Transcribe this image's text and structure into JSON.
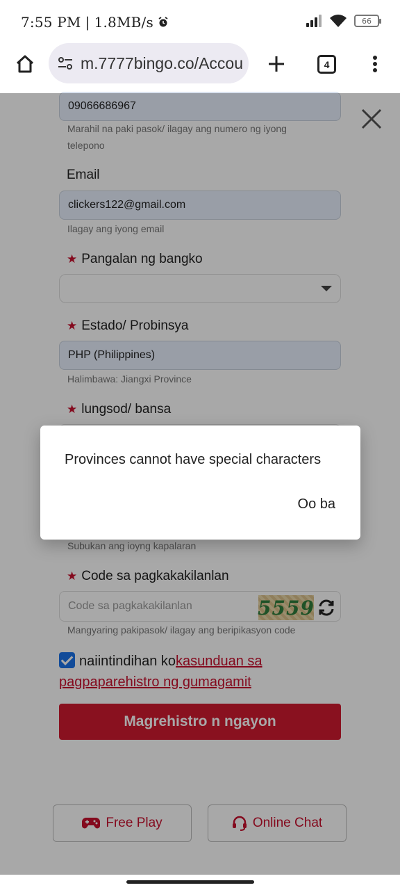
{
  "status_bar": {
    "time": "7:55 PM",
    "separator": "|",
    "speed": "1.8MB/s",
    "battery": "66"
  },
  "browser": {
    "url": "m.7777bingo.co/Accou",
    "tab_count": "4"
  },
  "form": {
    "phone_value": "09066686967",
    "phone_hint": "Marahil na paki pasok/ ilagay ang numero ng iyong telepono",
    "email_label": "Email",
    "email_value": "clickers122@gmail.com",
    "email_hint": "Ilagay ang iyong email",
    "bank_label": "Pangalan ng bangko",
    "bank_value": "",
    "province_label": "Estado/ Probinsya",
    "province_value": "PHP (Philippines)",
    "province_hint": "Halimbawa: Jiangxi Province",
    "city_label": "lungsod/ bansa",
    "luck_hint": "Subukan ang ioyng kapalaran",
    "code_label": "Code sa pagkakakilanlan",
    "code_placeholder": "Code sa pagkakakilanlan",
    "captcha_text": "5559",
    "code_hint": "Mangyaring pakipasok/ ilagay ang beripikasyon code",
    "agree_text": "naiintindihan ko",
    "agree_link": "kasunduan sa pagpaparehistro ng gumagamit",
    "register_label": "Magrehistro n ngayon"
  },
  "footer": {
    "free_play_label": "Free Play",
    "online_chat_label": "Online Chat"
  },
  "dialog": {
    "message": "Provinces cannot have special characters",
    "ok_label": "Oo ba"
  },
  "colors": {
    "accent": "#d11a2f",
    "checkbox": "#1a73e8"
  }
}
